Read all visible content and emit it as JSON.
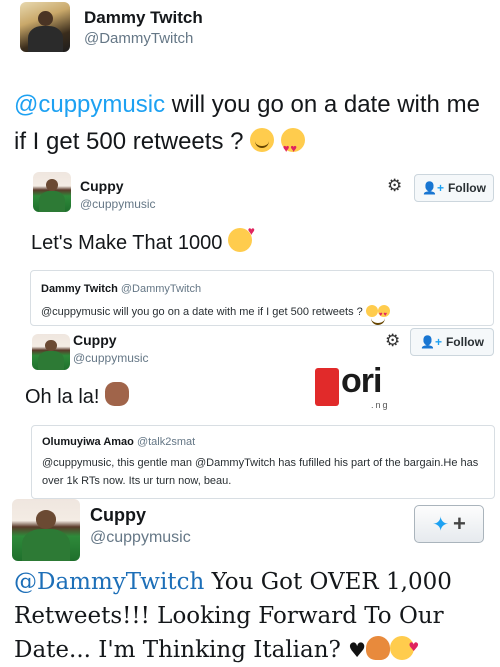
{
  "tweet1": {
    "name": "Dammy Twitch",
    "handle": "@DammyTwitch",
    "mention": "@cuppymusic",
    "text": " will you go on a date with me if I get 500 retweets ? ",
    "emojis": [
      "smiling-face-icon",
      "heart-eyes-icon"
    ]
  },
  "tweet2": {
    "name": "Cuppy",
    "handle": "@cuppymusic",
    "follow_label": "Follow",
    "text": "Let's Make That 1000",
    "quote": {
      "name": "Dammy Twitch",
      "handle": "@DammyTwitch",
      "text": "@cuppymusic will you go on a date with me if I get 500 retweets ?"
    }
  },
  "tweet3": {
    "name": "Cuppy",
    "handle": "@cuppymusic",
    "follow_label": "Follow",
    "text": "Oh la la!",
    "watermark": {
      "word": "ori",
      "sub": ".ng"
    },
    "quote": {
      "name": "Olumuyiwa Amao",
      "handle": "@talk2smat",
      "text": "@cuppymusic, this gentle man @DammyTwitch has fufilled his part of the bargain.He has over 1k RTs now. Its ur turn now, beau."
    }
  },
  "tweet4": {
    "name": "Cuppy",
    "handle": "@cuppymusic",
    "mention": "@DammyTwitch",
    "text": " You Got OVER 1,000 Retweets!!! Looking Forward To Our Date... I'm Thinking Italian? "
  },
  "colors": {
    "link": "#1da1f2",
    "text": "#14171a",
    "muted": "#657786",
    "brand_red": "#e12a2a"
  }
}
